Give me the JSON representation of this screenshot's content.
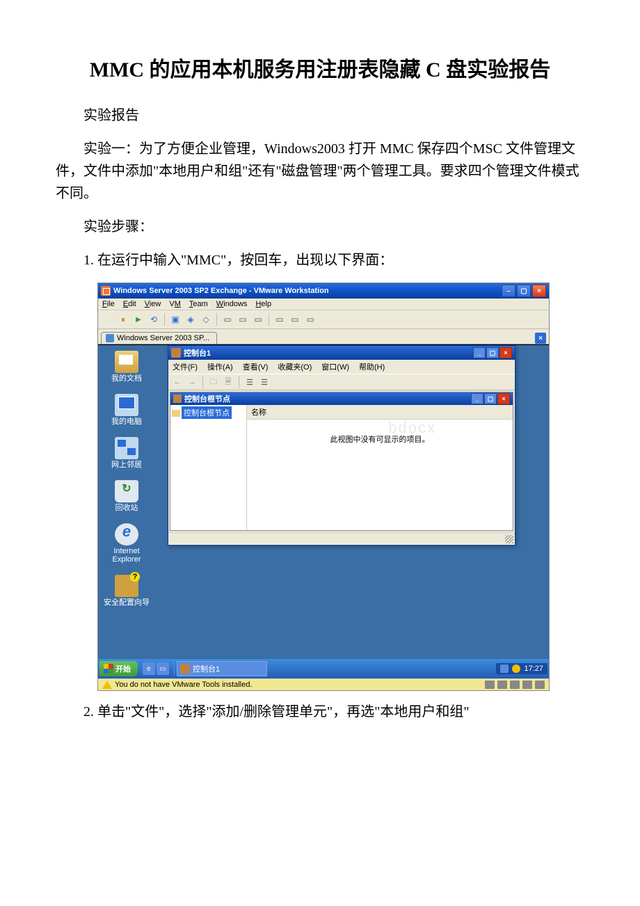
{
  "doc": {
    "title": "MMC 的应用本机服务用注册表隐藏 C 盘实验报告",
    "p_label": "实验报告",
    "p_exp1": "实验一：为了方便企业管理，Windows2003 打开 MMC 保存四个MSC 文件管理文件，文件中添加\"本地用户和组\"还有\"磁盘管理\"两个管理工具。要求四个管理文件模式不同。",
    "p_steps": "实验步骤：",
    "p_step1": "1. 在运行中输入\"MMC\"，按回车，出现以下界面：",
    "p_step2": "2. 单击\"文件\"，选择\"添加/删除管理单元\"，再选\"本地用户和组\""
  },
  "vm": {
    "title": "Windows Server 2003 SP2 Exchange - VMware Workstation",
    "menu": {
      "file": "File",
      "edit": "Edit",
      "view": "View",
      "vm": "VM",
      "team": "Team",
      "windows": "Windows",
      "help": "Help"
    },
    "tab": "Windows Server 2003 SP...",
    "status": "You do not have VMware Tools installed."
  },
  "desktop": {
    "icons": {
      "docs": "我的文档",
      "comp": "我的电脑",
      "net": "网上邻居",
      "bin": "回收站",
      "ie": "Internet Explorer",
      "sec": "安全配置向导"
    },
    "taskbar": {
      "start": "开始",
      "task": "控制台1",
      "time": "17:27"
    }
  },
  "mmc": {
    "title": "控制台1",
    "menu": {
      "file": "文件(F)",
      "action": "操作(A)",
      "view": "查看(V)",
      "fav": "收藏夹(O)",
      "window": "窗口(W)",
      "help": "帮助(H)"
    },
    "child_title": "控制台根节点",
    "root_node": "控制台根节点",
    "col_name": "名称",
    "empty": "此视图中没有可显示的项目。"
  }
}
